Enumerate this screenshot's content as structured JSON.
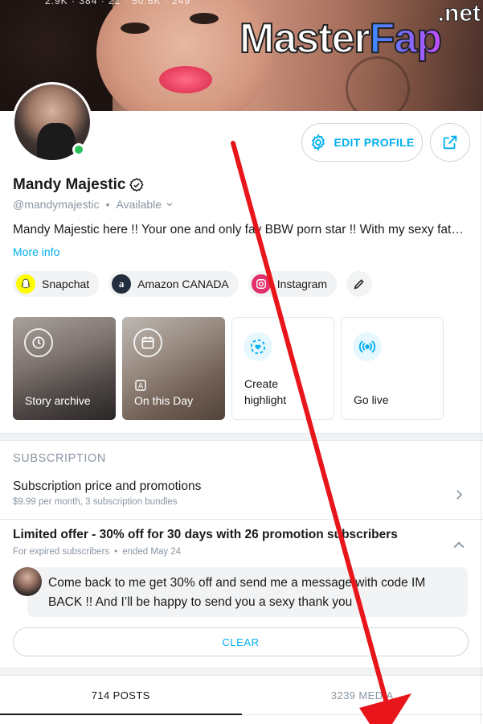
{
  "cover": {
    "stats": "2.9K  ·  384  ·  22  ·  50.6K  ·  249"
  },
  "watermark": {
    "master": "Master",
    "fap": "Fap",
    "net": ".net"
  },
  "header": {
    "edit_profile_label": "EDIT PROFILE"
  },
  "profile": {
    "name": "Mandy Majestic",
    "handle": "@mandymajestic",
    "separator": "•",
    "status": "Available",
    "bio": "Mandy Majestic here !! Your one and only fav BBW porn star !! With my sexy fat…",
    "more_info": "More info"
  },
  "social_links": [
    {
      "label": "Snapchat",
      "icon": "snapchat-icon",
      "color": "#fffc00"
    },
    {
      "label": "Amazon CANADA",
      "icon": "amazon-icon",
      "color": "#232f3e"
    },
    {
      "label": "Instagram",
      "icon": "instagram-icon",
      "color": "#e1306c"
    }
  ],
  "highlights": [
    {
      "label": "Story archive"
    },
    {
      "label": "On this Day",
      "badge": "A"
    },
    {
      "label_line1": "Create",
      "label_line2": "highlight"
    },
    {
      "label": "Go live"
    }
  ],
  "subscription": {
    "section_title": "SUBSCRIPTION",
    "price_title": "Subscription price and promotions",
    "price_sub": "$9.99 per month, 3 subscription bundles",
    "offer_title": "Limited offer - 30% off for 30 days with 26 promotion subscribers",
    "offer_audience": "For expired subscribers",
    "offer_separator": "•",
    "offer_end": "ended May 24",
    "message": "Come back to me get 30% off and send me a message with code IM BACK !! And I’ll be happy to send you a sexy thank you",
    "clear_label": "CLEAR"
  },
  "tabs": [
    {
      "label": "714 POSTS",
      "active": true
    },
    {
      "label": "3239 MEDIA",
      "active": false
    }
  ],
  "colors": {
    "accent": "#00aff0",
    "online": "#2dbf58",
    "arrow": "#e8161b"
  }
}
